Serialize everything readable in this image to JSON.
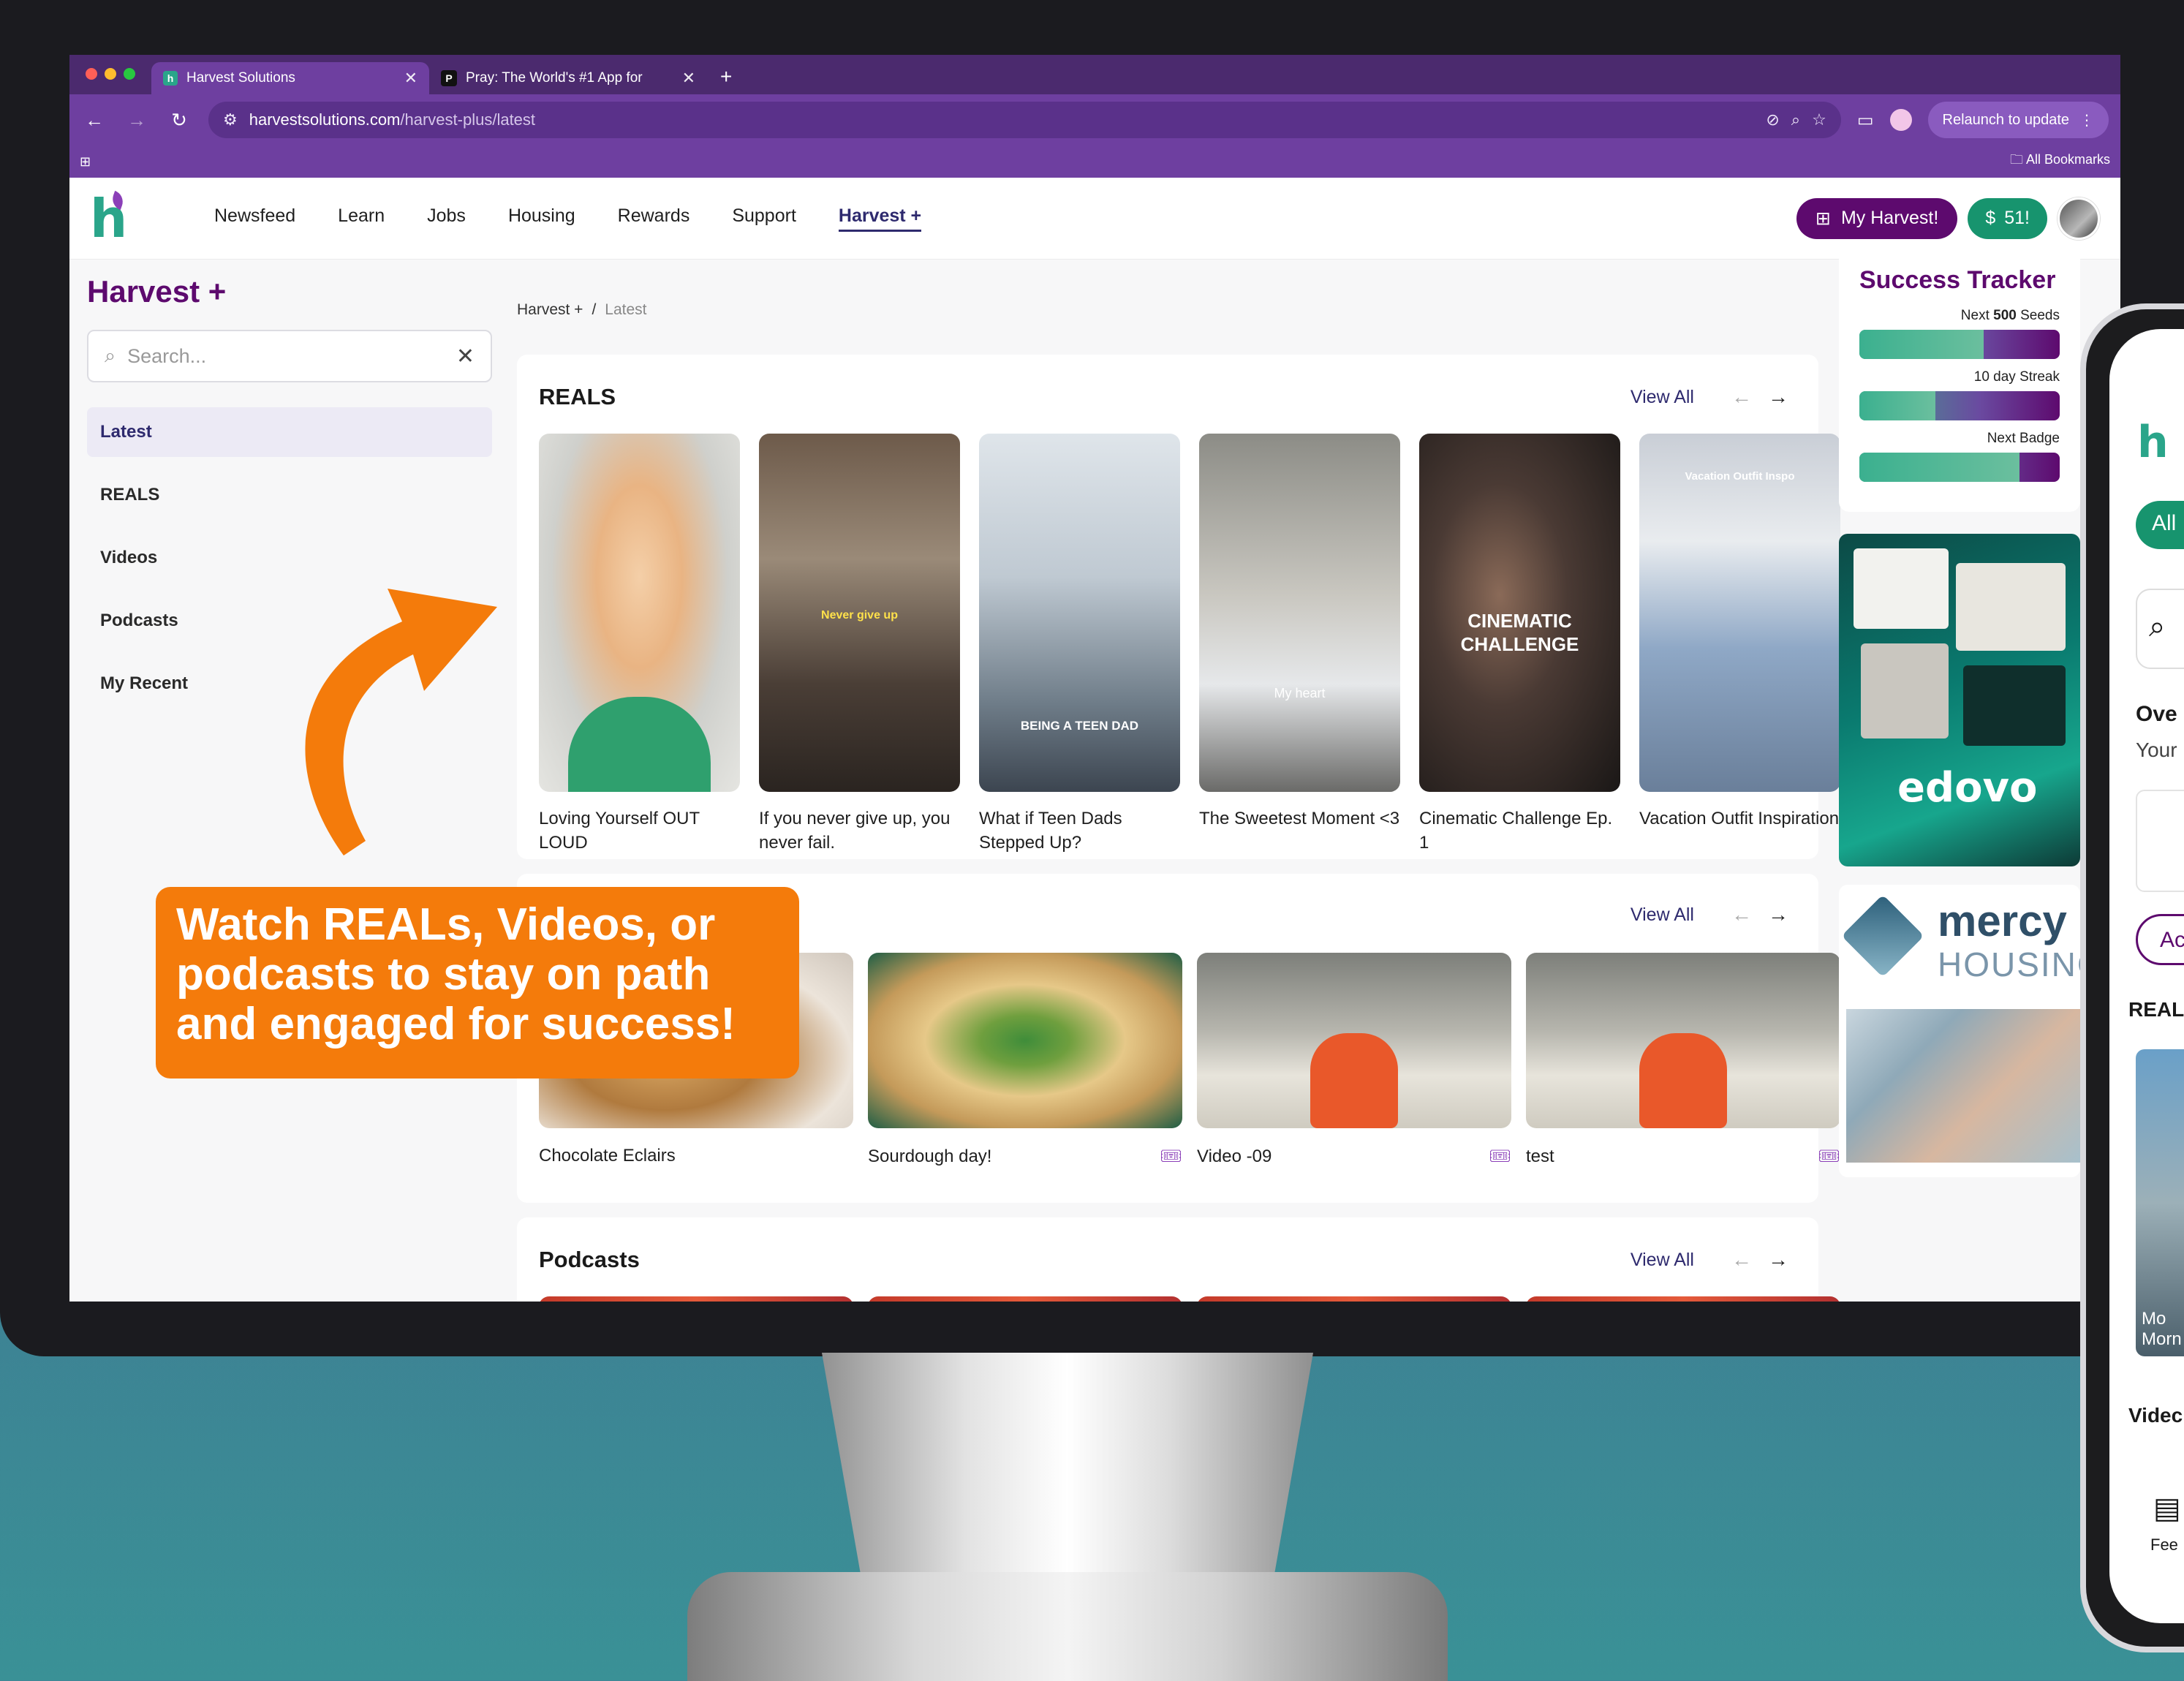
{
  "browser": {
    "tabs": [
      {
        "title": "Harvest Solutions",
        "active": true
      },
      {
        "title": "Pray: The World's #1 App for",
        "active": false
      }
    ],
    "url_host": "harvestsolutions.com",
    "url_path": "/harvest-plus/latest",
    "relaunch_label": "Relaunch to update",
    "bookmarks_label": "All Bookmarks",
    "favicon_h": "h",
    "favicon_p": "P"
  },
  "header": {
    "nav": [
      "Newsfeed",
      "Learn",
      "Jobs",
      "Housing",
      "Rewards",
      "Support",
      "Harvest +"
    ],
    "active_nav": "Harvest +",
    "my_harvest_label": "My Harvest!",
    "seeds_count": "51!",
    "logo_letter": "h"
  },
  "sidebar": {
    "title": "Harvest +",
    "search_placeholder": "Search...",
    "items": [
      {
        "label": "Latest",
        "active": true
      },
      {
        "label": "REALS",
        "active": false
      },
      {
        "label": "Videos",
        "active": false
      },
      {
        "label": "Podcasts",
        "active": false
      },
      {
        "label": "My Recent",
        "active": false
      }
    ]
  },
  "breadcrumb": {
    "parent": "Harvest +",
    "separator": "/",
    "current": "Latest"
  },
  "reals": {
    "title": "REALS",
    "view_all": "View All",
    "items": [
      {
        "caption": "Loving Yourself OUT LOUD",
        "overlay": ""
      },
      {
        "caption": "If you never give up, you never fail.",
        "overlay": "Never give up"
      },
      {
        "caption": "What if Teen Dads Stepped Up?",
        "overlay": "BEING A TEEN DAD"
      },
      {
        "caption": "The Sweetest Moment <3",
        "overlay": "My heart"
      },
      {
        "caption": "Cinematic Challenge Ep. 1",
        "overlay": "CINEMATIC CHALLENGE"
      },
      {
        "caption": "Vacation Outfit Inspiration",
        "overlay": "Vacation Outfit Inspo"
      }
    ]
  },
  "videos": {
    "view_all": "View All",
    "items": [
      {
        "title": "Chocolate Eclairs",
        "ticket": false
      },
      {
        "title": "Sourdough day!",
        "ticket": true
      },
      {
        "title": "Video -09",
        "ticket": true
      },
      {
        "title": "test",
        "ticket": true
      }
    ]
  },
  "podcasts": {
    "title": "Podcasts",
    "view_all": "View All"
  },
  "tracker": {
    "title": "Success Tracker",
    "items": [
      {
        "prefix": "Next ",
        "bold": "500",
        "suffix": " Seeds",
        "progress": 0.62
      },
      {
        "prefix": "",
        "bold": "",
        "suffix": "10 day Streak",
        "progress": 0.38
      },
      {
        "prefix": "",
        "bold": "",
        "suffix": "Next Badge",
        "progress": 0.8
      }
    ]
  },
  "ads": {
    "edovo_brand": "edovo",
    "mercy_name": "mercy",
    "mercy_sub": "HOUSING"
  },
  "phone": {
    "chip": "All",
    "over": "Ove",
    "your": "Your",
    "btn": "Ac",
    "reals": "REAL",
    "thumb_cap": "Mo\nMorn",
    "videos": "Videc",
    "feed": "Fee"
  },
  "callout": {
    "text": "Watch REALs, Videos, or podcasts to stay on path and engaged for success!"
  },
  "colors": {
    "brand_purple": "#5d0a6e",
    "brand_green": "#17946e",
    "callout_orange": "#f47b0b",
    "chrome_purple": "#6e3fa0"
  }
}
